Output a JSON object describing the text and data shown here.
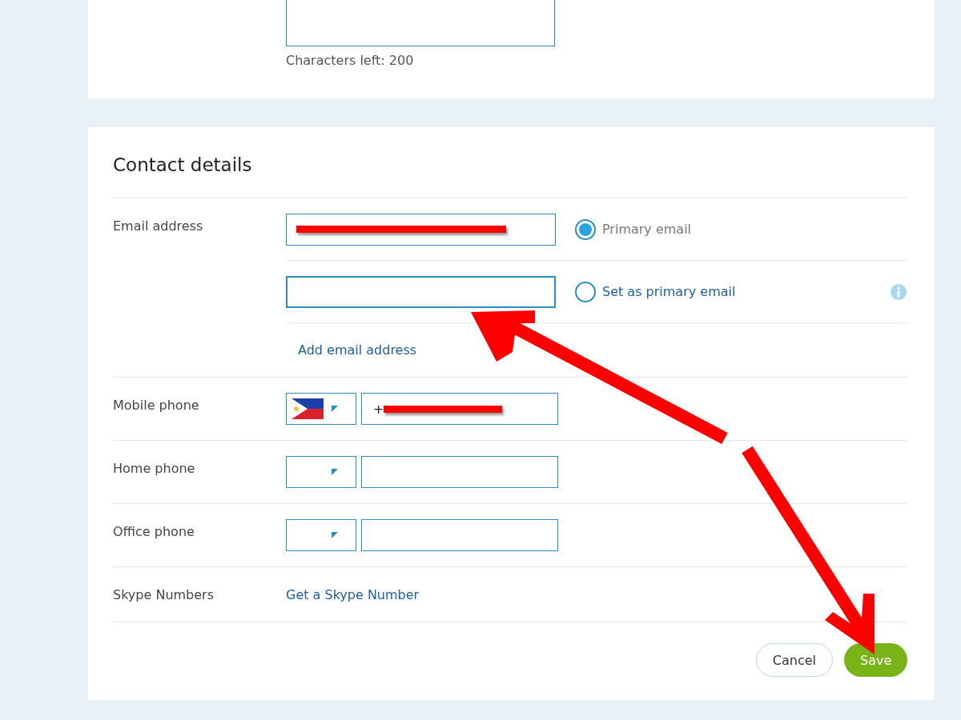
{
  "about_card": {
    "characters_left": "Characters left: 200"
  },
  "contact": {
    "heading": "Contact details",
    "email": {
      "label": "Email address",
      "addresses": [
        {
          "redacted": true,
          "option": {
            "label": "Primary email",
            "selected": true
          },
          "info": false
        },
        {
          "redacted": false,
          "option": {
            "label": "Set as primary email",
            "selected": false
          },
          "info": true
        }
      ],
      "add_link": "Add email address"
    },
    "phones": [
      {
        "label": "Mobile phone",
        "flag": true,
        "value": "+",
        "redacted": true
      },
      {
        "label": "Home phone",
        "flag": false,
        "redacted": false
      },
      {
        "label": "Office phone",
        "flag": false,
        "redacted": false
      }
    ],
    "skype_numbers": {
      "label": "Skype Numbers",
      "link": "Get a Skype Number"
    },
    "buttons": [
      {
        "label": "Cancel",
        "kind": "secondary"
      },
      {
        "label": "Save",
        "kind": "primary"
      }
    ]
  },
  "annotations": [
    {
      "kind": "arrow"
    },
    {
      "kind": "arrow"
    }
  ]
}
